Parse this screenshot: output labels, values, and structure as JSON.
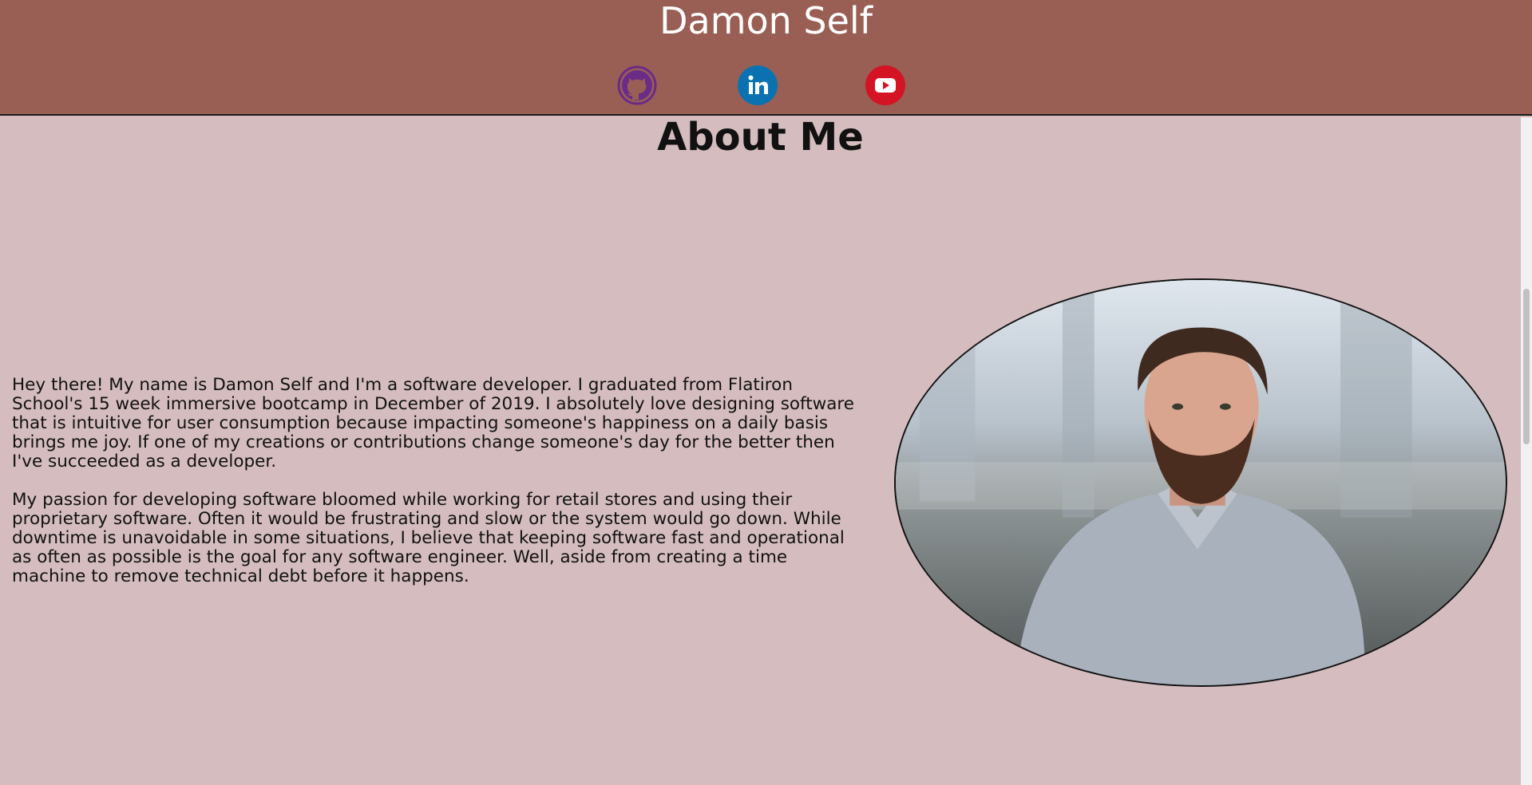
{
  "header": {
    "title": "Damon Self",
    "background_color": "#9a5f54",
    "social_links": [
      {
        "name": "github",
        "icon": "github-icon",
        "color": "#6a2c86"
      },
      {
        "name": "linkedin",
        "icon": "linkedin-icon",
        "color": "#0a72b1"
      },
      {
        "name": "youtube",
        "icon": "youtube-icon",
        "color": "#d41324"
      }
    ]
  },
  "main": {
    "heading": "About Me",
    "background_color": "#d5bdbf",
    "paragraphs": [
      "Hey there! My name is Damon Self and I'm a software developer. I graduated from Flatiron School's 15 week immersive bootcamp in December of 2019. I absolutely love designing software that is intuitive for user consumption because impacting someone's happiness on a daily basis brings me joy. If one of my creations or contributions change someone's day for the better then I've succeeded as a developer.",
      "My passion for developing software bloomed while working for retail stores and using their proprietary software. Often it would be frustrating and slow or the system would go down. While downtime is unavoidable in some situations, I believe that keeping software fast and operational as often as possible is the goal for any software engineer. Well, aside from creating a time machine to remove technical debt before it happens."
    ],
    "portrait": {
      "subject": "profile-photo"
    }
  }
}
